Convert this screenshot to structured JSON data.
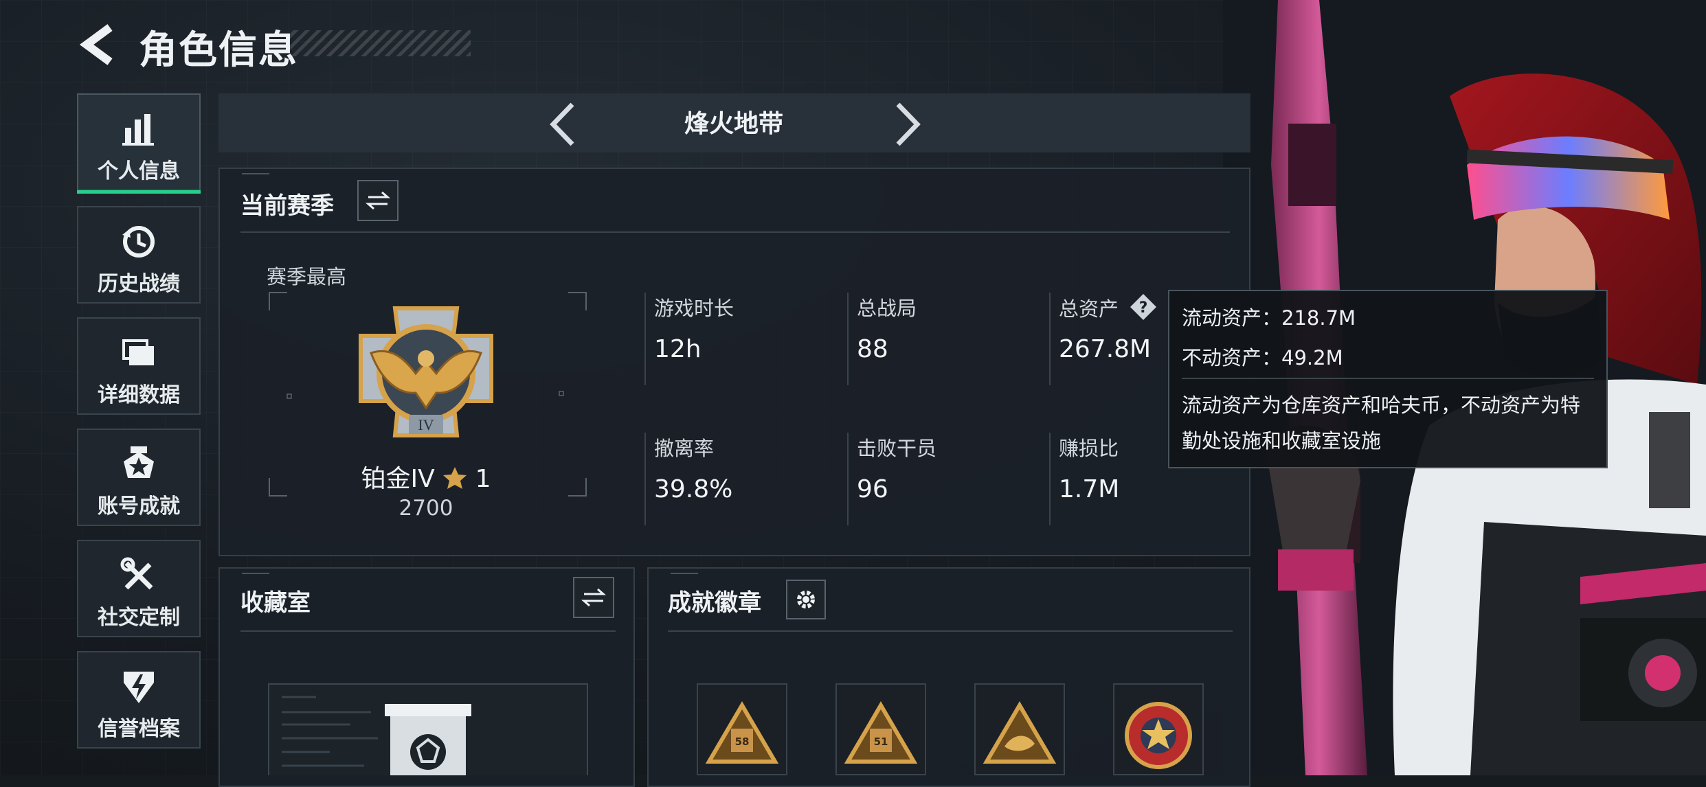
{
  "header": {
    "title": "角色信息"
  },
  "sidebar": {
    "items": [
      {
        "label": "个人信息",
        "icon": "bar-chart-icon",
        "active": true
      },
      {
        "label": "历史战绩",
        "icon": "history-clock-icon",
        "active": false
      },
      {
        "label": "详细数据",
        "icon": "folder-stack-icon",
        "active": false
      },
      {
        "label": "账号成就",
        "icon": "medal-star-icon",
        "active": false
      },
      {
        "label": "社交定制",
        "icon": "tools-icon",
        "active": false
      },
      {
        "label": "信誉档案",
        "icon": "shield-bolt-icon",
        "active": false
      }
    ]
  },
  "mode": {
    "label": "烽火地带"
  },
  "season": {
    "title": "当前赛季",
    "best_label": "赛季最高",
    "rank_name": "铂金IV",
    "rank_stars": "1",
    "rank_points": "2700",
    "rank_badge_numeral": "IV",
    "stats": [
      {
        "label": "游戏时长",
        "value": "12h"
      },
      {
        "label": "总战局",
        "value": "88"
      },
      {
        "label": "总资产",
        "value": "267.8M"
      },
      {
        "label": "撤离率",
        "value": "39.8%"
      },
      {
        "label": "击败干员",
        "value": "96"
      },
      {
        "label": "赚损比",
        "value": "1.7M"
      }
    ]
  },
  "tooltip": {
    "liquid": "流动资产：218.7M",
    "fixed": "不动资产：49.2M",
    "description": "流动资产为仓库资产和哈夫币，不动资产为特勤处设施和收藏室设施"
  },
  "collection": {
    "title": "收藏室"
  },
  "achievements": {
    "title": "成就徽章",
    "badges": [
      {
        "icon": "triangle-badge-icon",
        "label": "58"
      },
      {
        "icon": "triangle-badge-icon",
        "label": "51"
      },
      {
        "icon": "triangle-fish-badge-icon",
        "label": ""
      },
      {
        "icon": "round-star-badge-icon",
        "label": ""
      }
    ]
  },
  "colors": {
    "accent": "#25d08a",
    "gold": "#d6a24a",
    "tooltip_bg": "#111418"
  }
}
